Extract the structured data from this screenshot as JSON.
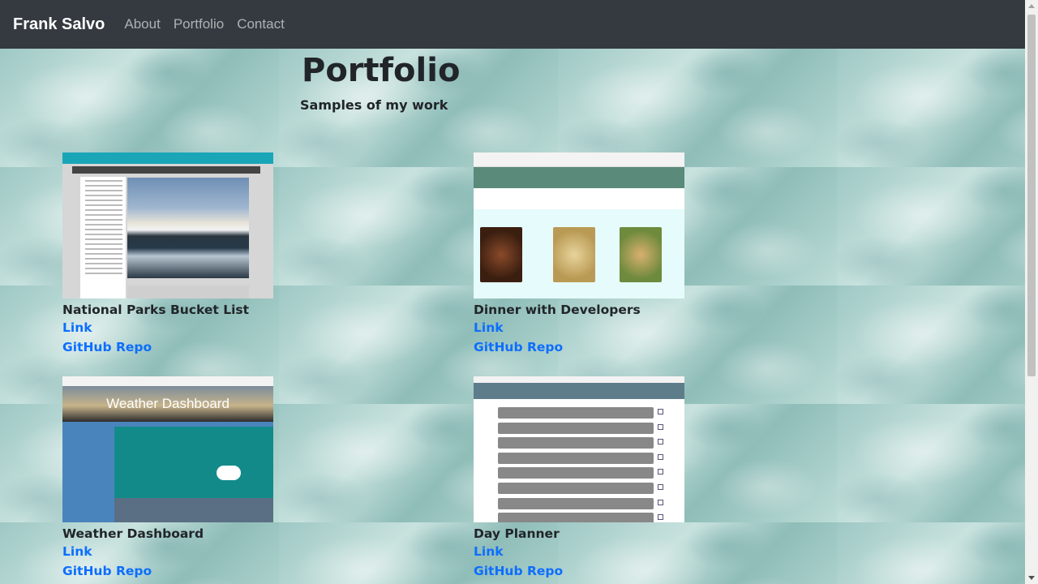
{
  "nav": {
    "brand": "Frank Salvo",
    "links": [
      "About",
      "Portfolio",
      "Contact"
    ]
  },
  "header": {
    "title": "Portfolio",
    "subtitle": "Samples of my work"
  },
  "projects": [
    {
      "title": "National Parks Bucket List",
      "link_label": "Link",
      "repo_label": "GitHub Repo"
    },
    {
      "title": "Dinner with Developers",
      "link_label": "Link",
      "repo_label": "GitHub Repo"
    },
    {
      "title": "Weather Dashboard",
      "link_label": "Link",
      "repo_label": "GitHub Repo"
    },
    {
      "title": "Day Planner",
      "link_label": "Link",
      "repo_label": "GitHub Repo"
    }
  ],
  "thumbnails": {
    "weather_hero": "Weather Dashboard"
  },
  "colors": {
    "navbar": "#343a40",
    "link": "#0d6efd",
    "text": "#212529"
  }
}
